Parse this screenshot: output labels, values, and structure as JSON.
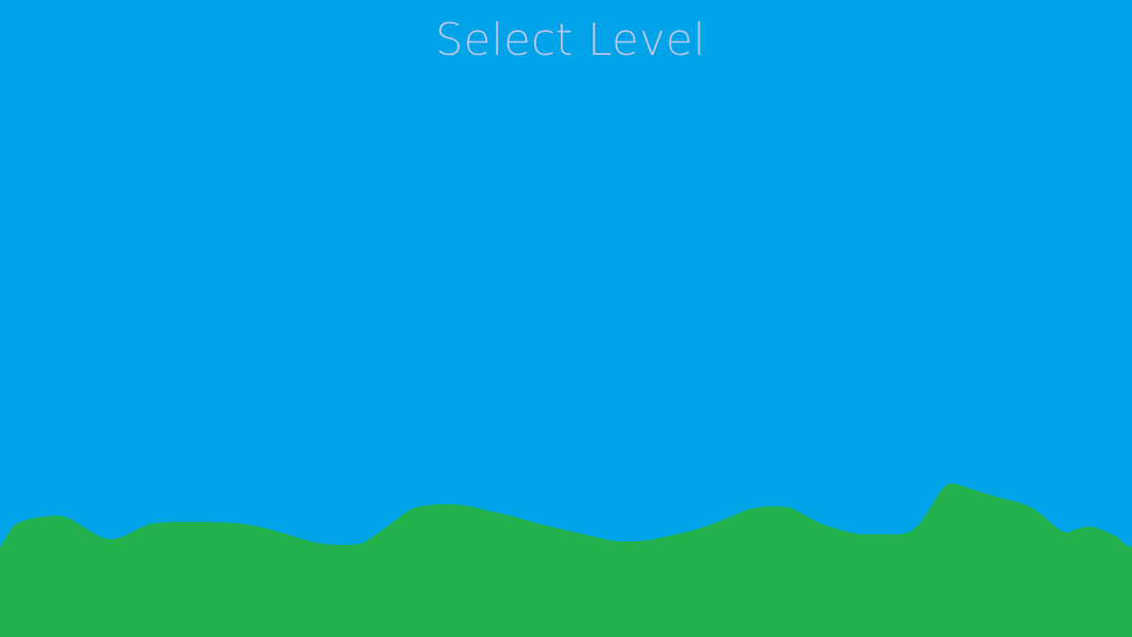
{
  "screen": {
    "title": "Select Level"
  },
  "level_select": {
    "levels": []
  },
  "colors": {
    "sky": "#00A2E8",
    "ground": "#22B14C",
    "title_text": "#B6C6F2"
  }
}
